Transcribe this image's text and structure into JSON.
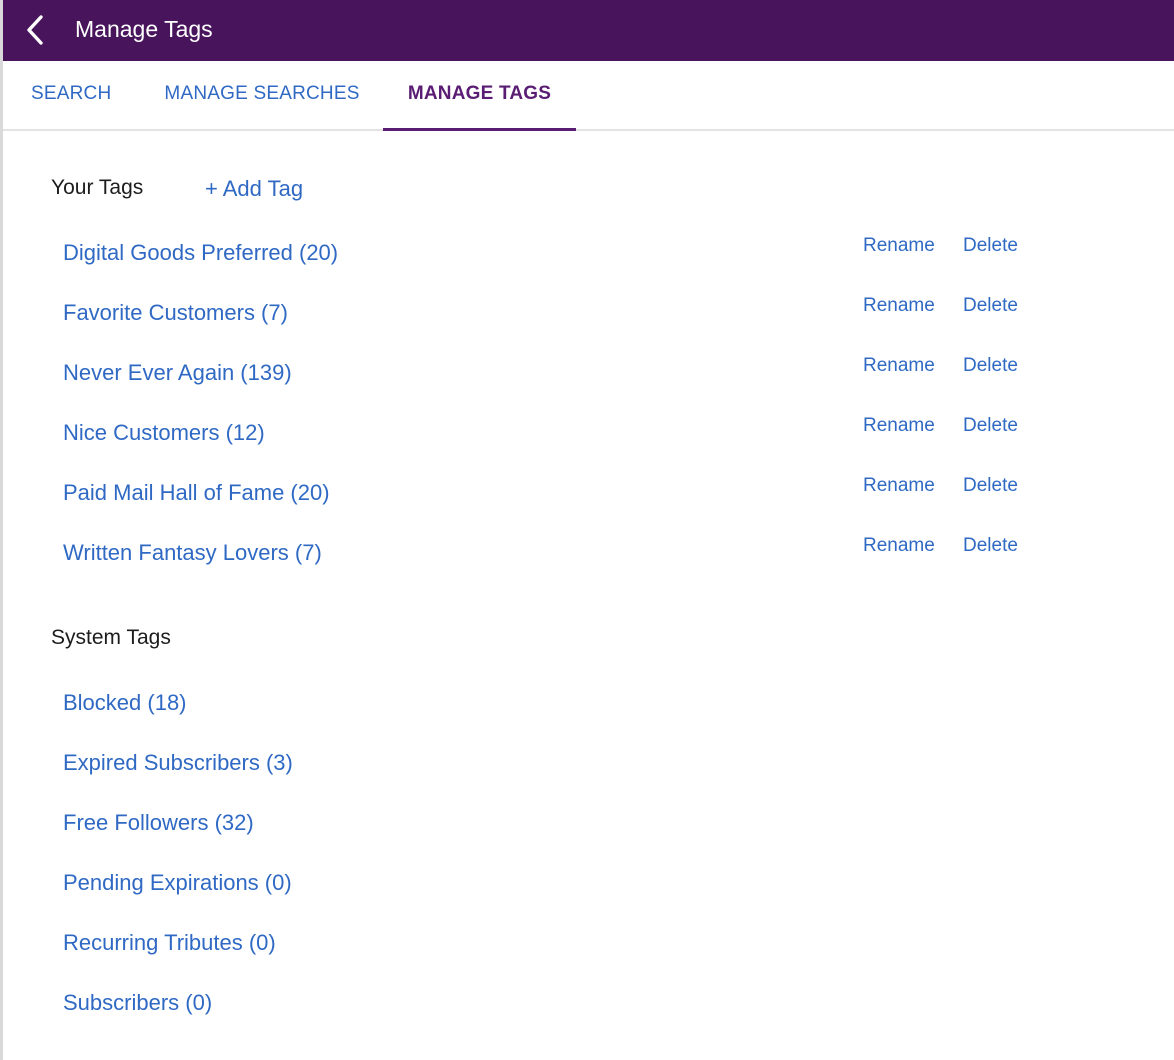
{
  "header": {
    "title": "Manage Tags",
    "back_icon": "chevron-left-icon",
    "background": "#48145c"
  },
  "tabs": [
    {
      "label": "SEARCH",
      "active": false
    },
    {
      "label": "MANAGE SEARCHES",
      "active": false
    },
    {
      "label": "MANAGE TAGS",
      "active": true
    }
  ],
  "your_tags": {
    "title": "Your Tags",
    "add_label": "+ Add Tag",
    "rename_label": "Rename",
    "delete_label": "Delete",
    "items": [
      {
        "label": "Digital Goods Preferred (20)"
      },
      {
        "label": "Favorite Customers (7)"
      },
      {
        "label": "Never Ever Again (139)"
      },
      {
        "label": "Nice Customers (12)"
      },
      {
        "label": "Paid Mail Hall of Fame (20)"
      },
      {
        "label": "Written Fantasy Lovers (7)"
      }
    ]
  },
  "system_tags": {
    "title": "System Tags",
    "items": [
      {
        "label": "Blocked (18)"
      },
      {
        "label": "Expired Subscribers (3)"
      },
      {
        "label": "Free Followers (32)"
      },
      {
        "label": "Pending Expirations (0)"
      },
      {
        "label": "Recurring Tributes (0)"
      },
      {
        "label": "Subscribers (0)"
      }
    ]
  },
  "colors": {
    "accent": "#5a1d73",
    "link": "#2f69c4"
  }
}
